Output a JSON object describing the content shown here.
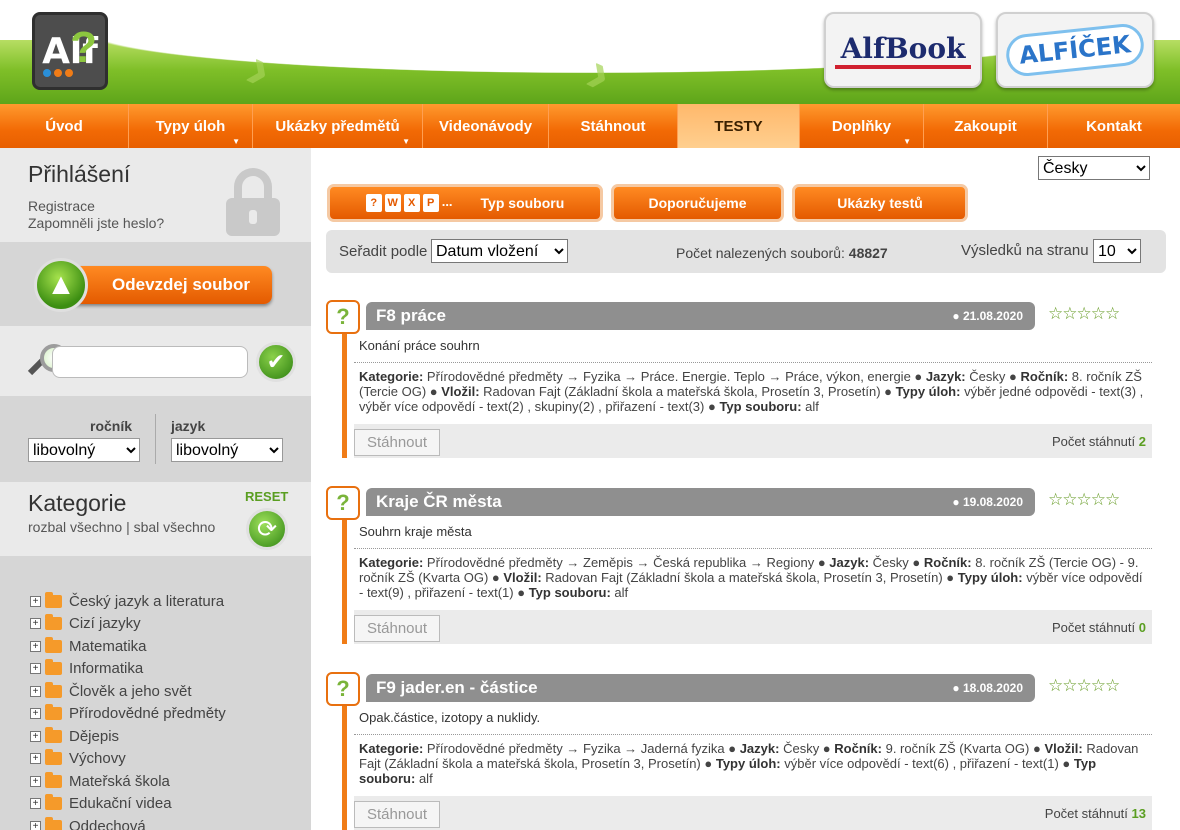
{
  "header": {
    "logo_text": "Alf",
    "promo1": "AlfBook",
    "promo2": "ALFÍČEK"
  },
  "nav": [
    {
      "label": "Úvod",
      "dropdown": false,
      "active": false
    },
    {
      "label": "Typy úloh",
      "dropdown": true,
      "active": false
    },
    {
      "label": "Ukázky předmětů",
      "dropdown": true,
      "active": false
    },
    {
      "label": "Videonávody",
      "dropdown": false,
      "active": false
    },
    {
      "label": "Stáhnout",
      "dropdown": false,
      "active": false
    },
    {
      "label": "TESTY",
      "dropdown": false,
      "active": true
    },
    {
      "label": "Doplňky",
      "dropdown": true,
      "active": false
    },
    {
      "label": "Zakoupit",
      "dropdown": false,
      "active": false
    },
    {
      "label": "Kontakt",
      "dropdown": false,
      "active": false
    }
  ],
  "sidebar": {
    "login_title": "Přihlášení",
    "register_link": "Registrace",
    "forgot_link": "Zapomněli jste heslo?",
    "upload_label": "Odevzdej soubor",
    "search_value": "",
    "grade_label": "ročník",
    "grade_value": "libovolný",
    "language_label": "jazyk",
    "language_value": "libovolný",
    "categories_title": "Kategorie",
    "expand_all": "rozbal všechno",
    "collapse_all": "sbal všechno",
    "separator": "|",
    "reset_label": "RESET",
    "tree": [
      "Český jazyk a literatura",
      "Cizí jazyky",
      "Matematika",
      "Informatika",
      "Člověk a jeho svět",
      "Přírodovědné předměty",
      "Dějepis",
      "Výchovy",
      "Mateřská škola",
      "Edukační videa",
      "Oddechová"
    ]
  },
  "main": {
    "language_select": "Česky",
    "tabs": {
      "file_type": "Typ souboru",
      "file_type_icons": [
        "?",
        "W",
        "X",
        "P"
      ],
      "more": "...",
      "recommended": "Doporučujeme",
      "test_samples": "Ukázky testů"
    },
    "sort": {
      "label": "Seřadit podle",
      "value": "Datum vložení",
      "found_label": "Počet nalezených souborů:",
      "found_count": "48827",
      "per_page_label": "Výsledků na stranu",
      "per_page_value": "10"
    },
    "results": [
      {
        "title": "F8 práce",
        "date": "● 21.08.2020",
        "stars": "☆☆☆☆☆",
        "description": "Konání práce souhrn",
        "cat_label": "Kategorie:",
        "cat_value": "Přírodovědné předměty → Fyzika → Práce. Energie. Teplo → Práce, výkon, energie ●",
        "lang_label": "Jazyk:",
        "lang_value": "Česky ●",
        "grade_label": "Ročník:",
        "grade_value": "8. ročník ZŠ (Tercie OG) ●",
        "author_label": "Vložil:",
        "author_value": "Radovan Fajt (Základní škola a mateřská škola, Prosetín 3, Prosetín) ●",
        "types_label": "Typy úloh:",
        "types_value": "výběr jedné odpovědi - text(3) , výběr více odpovědí - text(2) , skupiny(2) , přiřazení - text(3) ●",
        "filetype_label": "Typ souboru:",
        "filetype_value": "alf",
        "download": "Stáhnout",
        "downloads_label": "Počet stáhnutí",
        "downloads_count": "2"
      },
      {
        "title": "Kraje ČR města",
        "date": "● 19.08.2020",
        "stars": "☆☆☆☆☆",
        "description": "Souhrn kraje města",
        "cat_label": "Kategorie:",
        "cat_value": "Přírodovědné předměty → Zeměpis → Česká republika → Regiony ●",
        "lang_label": "Jazyk:",
        "lang_value": "Česky ●",
        "grade_label": "Ročník:",
        "grade_value": "8. ročník ZŠ (Tercie OG) - 9. ročník ZŠ (Kvarta OG) ●",
        "author_label": "Vložil:",
        "author_value": "Radovan Fajt (Základní škola a mateřská škola, Prosetín 3, Prosetín) ●",
        "types_label": "Typy úloh:",
        "types_value": "výběr více odpovědí - text(9) , přiřazení - text(1) ●",
        "filetype_label": "Typ souboru:",
        "filetype_value": "alf",
        "download": "Stáhnout",
        "downloads_label": "Počet stáhnutí",
        "downloads_count": "0"
      },
      {
        "title": "F9 jader.en - částice",
        "date": "● 18.08.2020",
        "stars": "☆☆☆☆☆",
        "description": "Opak.částice, izotopy a nuklidy.",
        "cat_label": "Kategorie:",
        "cat_value": "Přírodovědné předměty → Fyzika → Jaderná fyzika ●",
        "lang_label": "Jazyk:",
        "lang_value": "Česky ●",
        "grade_label": "Ročník:",
        "grade_value": "9. ročník ZŠ (Kvarta OG) ●",
        "author_label": "Vložil:",
        "author_value": "Radovan Fajt (Základní škola a mateřská škola, Prosetín 3, Prosetín) ●",
        "types_label": "Typy úloh:",
        "types_value": "výběr více odpovědí - text(6) , přiřazení - text(1) ●",
        "filetype_label": "Typ souboru:",
        "filetype_value": "alf",
        "download": "Stáhnout",
        "downloads_label": "Počet stáhnutí",
        "downloads_count": "13"
      }
    ]
  }
}
